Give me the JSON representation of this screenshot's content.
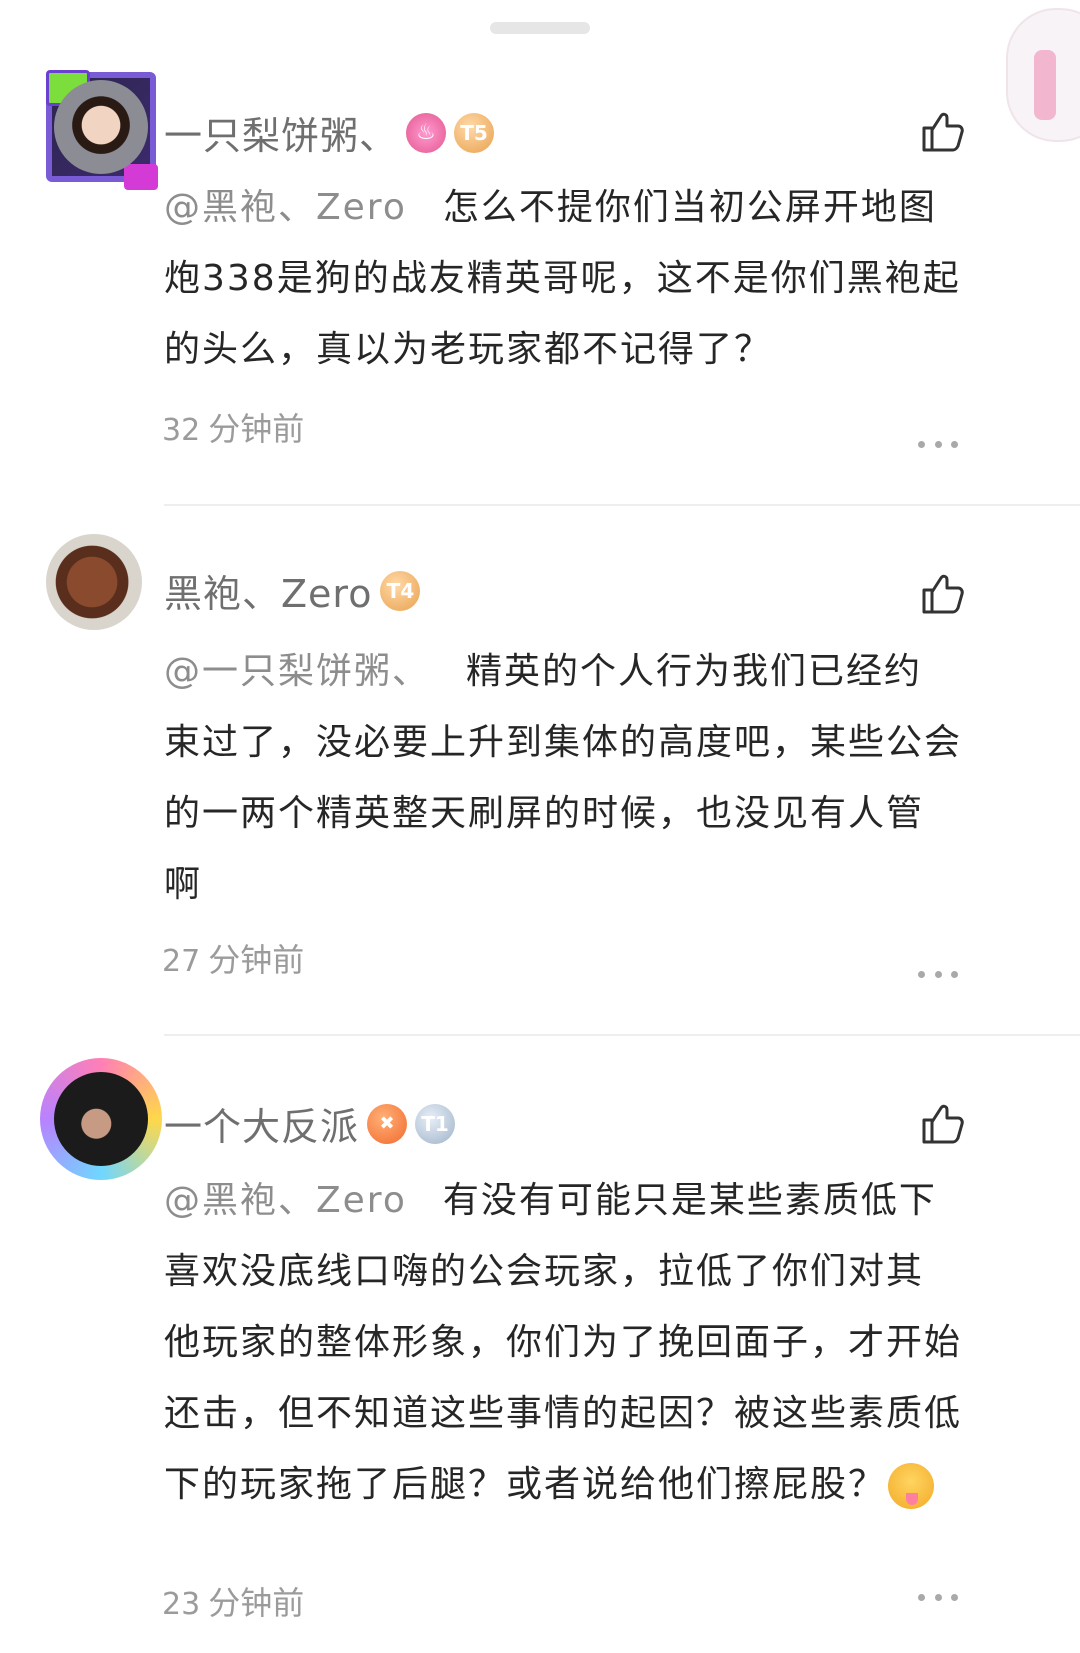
{
  "comments": [
    {
      "username": "一只梨饼粥、",
      "badges": [
        "fire-badge",
        "T5"
      ],
      "mention": "@黑袍、Zero",
      "lines": [
        "怎么不提你们当初公屏开地图",
        "炮338是狗的战友精英哥呢，这不是你们黑袍起",
        "的头么，真以为老玩家都不记得了？"
      ],
      "time_num": "32",
      "time_unit": "分钟前"
    },
    {
      "username": "黑袍、Zero",
      "badges": [
        "T4"
      ],
      "mention": "@一只梨饼粥、",
      "lines": [
        "精英的个人行为我们已经约",
        "束过了，没必要上升到集体的高度吧，某些公会",
        "的一两个精英整天刷屏的时候，也没见有人管",
        "啊"
      ],
      "time_num": "27",
      "time_unit": "分钟前"
    },
    {
      "username": "一个大反派",
      "badges": [
        "game-badge",
        "T1"
      ],
      "mention": "@黑袍、Zero",
      "lines": [
        "有没有可能只是某些素质低下",
        "喜欢没底线口嗨的公会玩家，拉低了你们对其",
        "他玩家的整体形象，你们为了挽回面子，才开始",
        "还击，但不知道这些事情的起因？被这些素质低",
        "下的玩家拖了后腿？或者说给他们擦屁股？"
      ],
      "time_num": "23",
      "time_unit": "分钟前"
    }
  ],
  "icons": {
    "like": "thumbs-up-icon",
    "more": "more-dots-icon",
    "emoji": "drooling-face-emoji"
  },
  "colors": {
    "username": "#6f6f6f",
    "mention": "#8d8d8d",
    "body": "#262626",
    "meta": "#9b9b9b"
  }
}
